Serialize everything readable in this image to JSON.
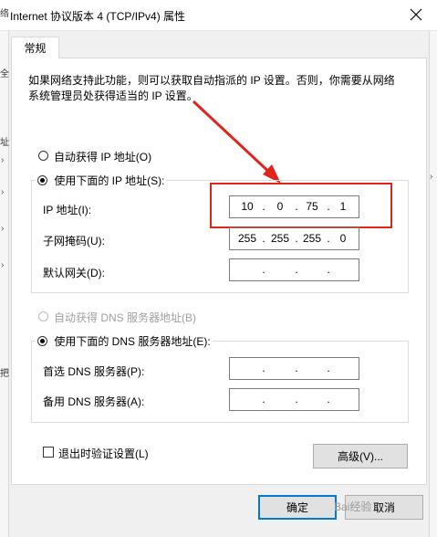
{
  "window": {
    "title": "Internet 协议版本 4 (TCP/IPv4) 属性"
  },
  "background_glyphs": [
    "络",
    "全",
    "址",
    "把"
  ],
  "tab": {
    "label": "常规"
  },
  "description": "如果网络支持此功能，则可以获取自动指派的 IP 设置。否则，你需要从网络系统管理员处获得适当的 IP 设置。",
  "ip_section": {
    "auto_label": "自动获得 IP 地址(O)",
    "manual_label": "使用下面的 IP 地址(S):",
    "selected": "manual",
    "fields": [
      {
        "label": "IP 地址(I):",
        "octets": [
          "10",
          "0",
          "75",
          "1"
        ]
      },
      {
        "label": "子网掩码(U):",
        "octets": [
          "255",
          "255",
          "255",
          "0"
        ]
      },
      {
        "label": "默认网关(D):",
        "octets": [
          "",
          "",
          "",
          ""
        ]
      }
    ]
  },
  "dns_section": {
    "auto_label": "自动获得 DNS 服务器地址(B)",
    "auto_disabled": true,
    "manual_label": "使用下面的 DNS 服务器地址(E):",
    "selected": "manual",
    "fields": [
      {
        "label": "首选 DNS 服务器(P):",
        "octets": [
          "",
          "",
          "",
          ""
        ]
      },
      {
        "label": "备用 DNS 服务器(A):",
        "octets": [
          "",
          "",
          "",
          ""
        ]
      }
    ]
  },
  "validate_on_exit": {
    "label": "退出时验证设置(L)",
    "checked": false
  },
  "buttons": {
    "advanced": "高级(V)...",
    "ok": "确定",
    "cancel": "取消"
  },
  "watermark": "Bai经验",
  "colors": {
    "annotation_red": "#e2231a",
    "focus_blue": "#0078d7"
  }
}
